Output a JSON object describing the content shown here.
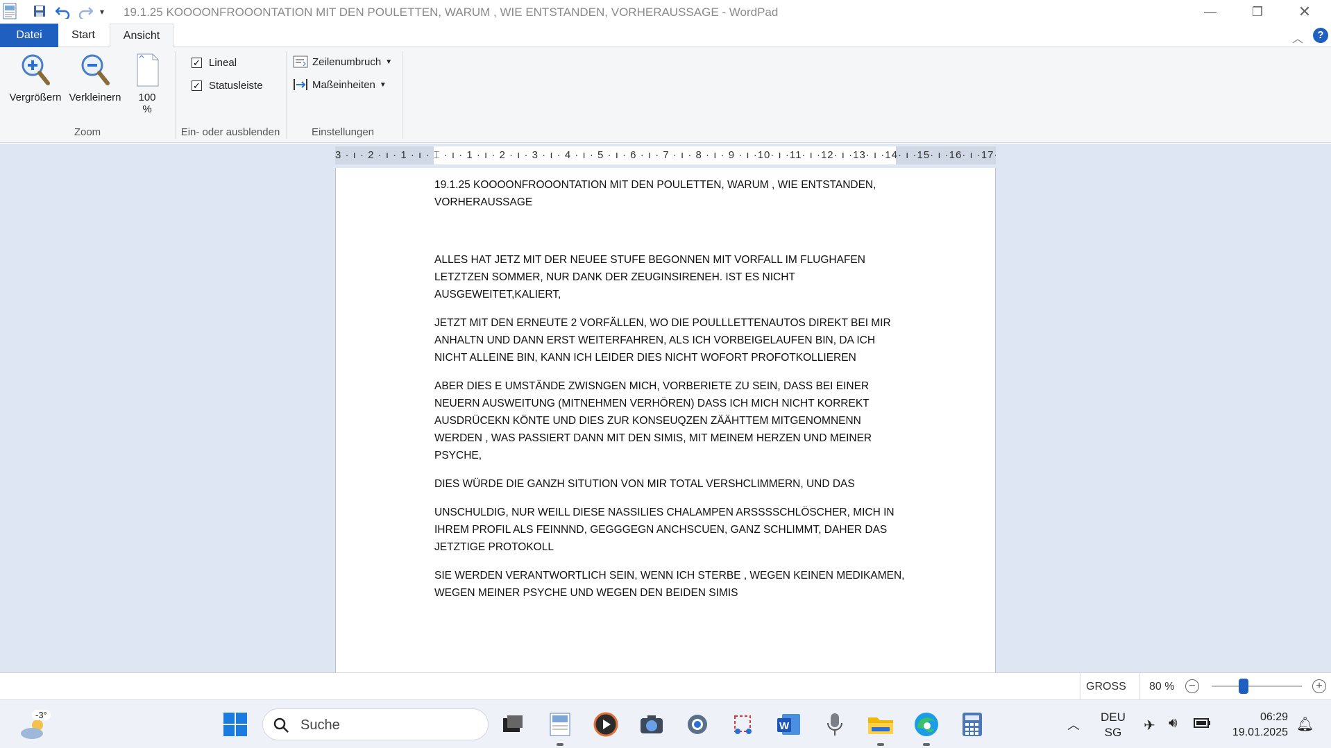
{
  "window": {
    "title": "19.1.25 KOOOONFROOONTATION MIT DEN POULETTEN, WARUM , WIE ENTSTANDEN, VORHERAUSSAGE - WordPad"
  },
  "tabs": [
    {
      "label": "Datei"
    },
    {
      "label": "Start"
    },
    {
      "label": "Ansicht"
    }
  ],
  "ribbon": {
    "zoom_group": {
      "label": "Zoom",
      "zoom_in": "Vergrößern",
      "zoom_out": "Verkleinern",
      "hundred_line1": "100",
      "hundred_line2": "%"
    },
    "show_group": {
      "label": "Ein- oder ausblenden",
      "ruler": "Lineal",
      "statusbar": "Statusleiste",
      "ruler_checked": true,
      "statusbar_checked": true
    },
    "settings_group": {
      "label": "Einstellungen",
      "wrap": "Zeilenumbruch",
      "units": "Maßeinheiten"
    }
  },
  "ruler": {
    "text": "3 · ı · 2 · ı · 1 · ı · ⌶ · ı · 1 · ı · 2 · ı · 3 · ı · 4 · ı · 5 · ı · 6 · ı · 7 · ı · 8 · ı · 9 · ı ·10· ı ·11· ı ·12· ı ·13· ı ·14· ı ·15· ı ·16· ı ·17· ı ·"
  },
  "document": {
    "paragraphs": [
      "19.1.25 KOOOONFROOONTATION MIT DEN POULETTEN, WARUM , WIE ENTSTANDEN, VORHERAUSSAGE",
      "",
      "ALLES HAT JETZ MIT DER NEUEE STUFE BEGONNEN MIT VORFALL IM FLUGHAFEN LETZTZEN SOMMER, NUR DANK DER ZEUGINSIRENEH. IST ES NICHT AUSGEWEITET,KALIERT,",
      "JETZT MIT DEN ERNEUTE 2 VORFÄLLEN, WO DIE POULLLETTENAUTOS DIREKT BEI MIR ANHALTN UND DANN ERST WEITERFAHREN, ALS ICH VORBEIGELAUFEN BIN, DA ICH NICHT ALLEINE BIN, KANN ICH LEIDER DIES NICHT WOFORT PROFOTKOLLIEREN",
      "ABER DIES E UMSTÄNDE ZWISNGEN MICH, VORBERIETE ZU SEIN, DASS BEI EINER NEUERN AUSWEITUNG (MITNEHMEN VERHÖREN) DASS ICH MICH NICHT KORREKT AUSDRÜCEKN KÖNTE UND DIES ZUR KONSEUQZEN ZÄÄHTTEM  MITGENOMNENN WERDEN , WAS PASSIERT DANN MIT DEN SIMIS, MIT MEINEM HERZEN UND MEINER PSYCHE,",
      "DIES WÜRDE DIE GANZH SITUTION VON MIR TOTAL VERSHCLIMMERN, UND DAS",
      "UNSCHULDIG, NUR WEILL DIESE NASSILIES CHALAMPEN ARSSSSCHLÖSCHER, MICH IN IHREM PROFIL ALS FEINNND, GEGGGEGN ANCHSCUEN, GANZ SCHLIMMT, DAHER DAS JETZTIGE PROTOKOLL",
      "SIE WERDEN VERANTWORTLICH SEIN, WENN ICH STERBE , WEGEN KEINEN MEDIKAMEN, WEGEN MEINER PSYCHE UND WEGEN DEN BEIDEN SIMIS"
    ]
  },
  "status": {
    "caps": "GROSS",
    "zoom": "80 %",
    "zoom_level": 0.35
  },
  "taskbar": {
    "weather": "-3°",
    "search_placeholder": "Suche",
    "lang": "DEU",
    "layout": "SG",
    "time": "06:29",
    "date": "19.01.2025"
  },
  "colors": {
    "accent": "#1f5fbf",
    "workspace": "#dde6f2"
  }
}
